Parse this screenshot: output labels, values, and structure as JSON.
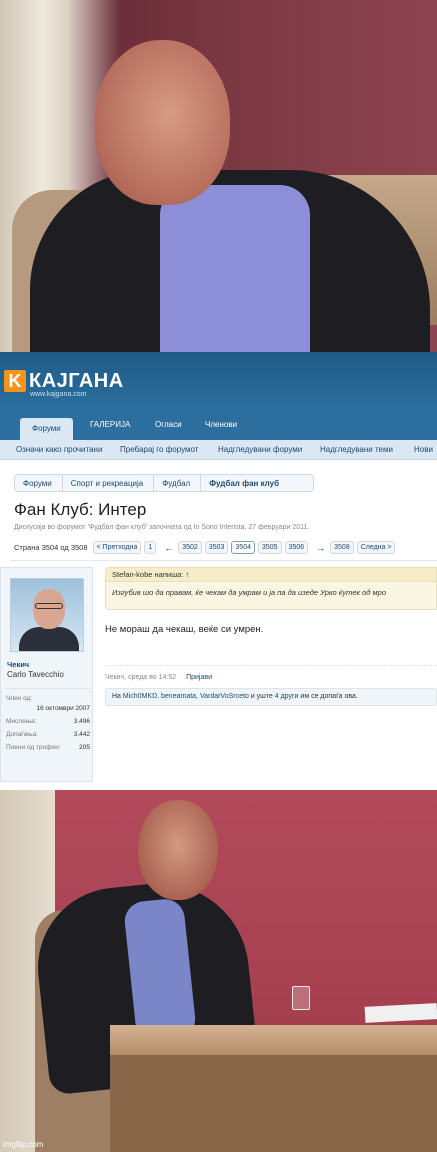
{
  "forum": {
    "logo_letter": "K",
    "logo_name": "КАЈГАНА",
    "logo_url": "www.kajgana.com",
    "tabs": [
      {
        "label": "Форуми"
      },
      {
        "label": "ГАЛЕРИЈА"
      },
      {
        "label": "Огласи"
      },
      {
        "label": "Членови"
      }
    ],
    "subnav": [
      {
        "label": "Означи како прочитани"
      },
      {
        "label": "Пребарај го форумот"
      },
      {
        "label": "Надгледувани форуми"
      },
      {
        "label": "Надгледувани теми"
      },
      {
        "label": "Нови"
      }
    ],
    "breadcrumb": [
      "Форуми",
      "Спорт и рекреација",
      "Фудбал",
      "Фудбал фан клуб"
    ],
    "thread_title": "Фан Клуб: Интер",
    "thread_desc": "Дискусија во форумот 'Фудбал фан клуб' започната од Io Sono Interista, 27 февруари 2011.",
    "pager": {
      "label": "Страна 3504 од 3508",
      "prev": "< Претходна",
      "first": "1",
      "pages": [
        "3502",
        "3503",
        "3504",
        "3505",
        "3506"
      ],
      "current": "3504",
      "last": "3508",
      "next": "Следна >"
    },
    "user": {
      "name": "Чекич",
      "title": "Carlo Tavecchio",
      "member_since_label": "Член од:",
      "member_since": "16 октомври 2007",
      "stats": [
        {
          "label": "Мислења:",
          "value": "3.496"
        },
        {
          "label": "Допаѓања:",
          "value": "3.442"
        },
        {
          "label": "Поени од трофеи:",
          "value": "205"
        }
      ]
    },
    "post": {
      "quote_author": "Stefan-kobe напиша: ↑",
      "quote_text": "Изгубив шо да правам, ќе чекам да умрам и ја па да изеде Урко ќутек од мро",
      "text": "Не мораш да чекаш, веќе си умрен.",
      "meta": "Чекич, среда во 14:52",
      "report": "Пријави",
      "likes_prefix": "На",
      "likers": "Mich0MKD, beneamata, VardarVoSrceto",
      "likes_and": "и уште",
      "likes_more": "4 други",
      "likes_suffix": "им се допаѓа ова."
    }
  },
  "watermark": "imgflip.com"
}
